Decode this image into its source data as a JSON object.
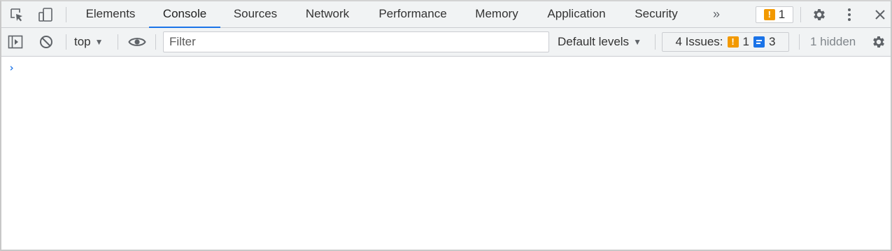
{
  "tabbar": {
    "tabs": [
      {
        "label": "Elements"
      },
      {
        "label": "Console"
      },
      {
        "label": "Sources"
      },
      {
        "label": "Network"
      },
      {
        "label": "Performance"
      },
      {
        "label": "Memory"
      },
      {
        "label": "Application"
      },
      {
        "label": "Security"
      }
    ],
    "active_tab": "Console",
    "more_tabs_glyph": "»",
    "issue_badge_count": "1"
  },
  "toolbar": {
    "context": "top",
    "filter_placeholder": "Filter",
    "filter_value": "",
    "levels_label": "Default levels",
    "issues_label": "4 Issues:",
    "issues_warning_count": "1",
    "issues_info_count": "3",
    "hidden_label": "1 hidden"
  },
  "console": {
    "prompt_glyph": "›"
  },
  "icons": {
    "inspect": "inspect-element-icon",
    "device": "device-toolbar-icon",
    "more_tabs": "more-tabs-icon",
    "settings": "gear-icon",
    "menu": "kebab-menu-icon",
    "close": "close-icon",
    "sidebar": "sidebar-toggle-icon",
    "clear": "clear-console-icon",
    "live_expression": "eye-icon",
    "console_settings": "gear-icon"
  },
  "colors": {
    "accent": "#1a73e8",
    "warning": "#f29900",
    "toolbar_bg": "#f1f3f4",
    "divider": "#cbcdd1"
  }
}
